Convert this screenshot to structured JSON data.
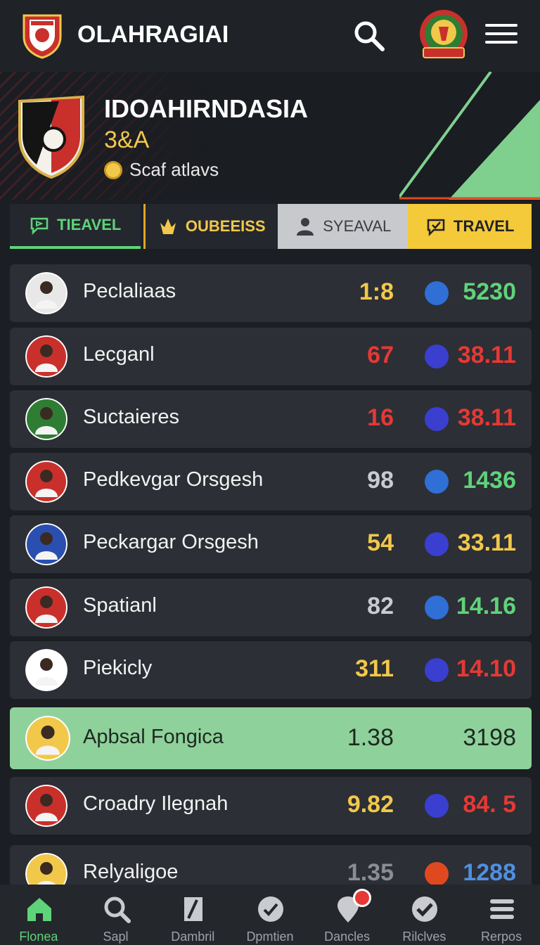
{
  "header": {
    "title": "OLAHRAGIAI",
    "search_icon": "search-icon",
    "menu_icon": "menu-icon"
  },
  "hero": {
    "team_name": "IDOAHIRNDASIA",
    "subtitle": "3&A",
    "meta_text": "Scaf atlavs"
  },
  "tabs": [
    {
      "label": "TIEAVEL",
      "icon": "chat-icon",
      "active": true
    },
    {
      "label": "OUBEEISS",
      "icon": "crown-icon"
    },
    {
      "label": "SYEAVAL",
      "icon": "user-icon"
    },
    {
      "label": "TRAVEL",
      "icon": "chat-check-icon"
    }
  ],
  "rows": [
    {
      "name": "Peclaliaas",
      "score": "1:8",
      "score_color": "#f2c84b",
      "dot_color": "#2f6fd6",
      "value": "5230",
      "value_color": "#5fd37a"
    },
    {
      "name": "Lecganl",
      "score": "67",
      "score_color": "#e53935",
      "dot_color": "#3a3fd0",
      "value": "38.11",
      "value_color": "#e53935"
    },
    {
      "name": "Suctaieres",
      "score": "16",
      "score_color": "#e53935",
      "dot_color": "#3a3fd0",
      "value": "38.11",
      "value_color": "#e53935"
    },
    {
      "name": "Pedkevgar Orsgesh",
      "score": "98",
      "score_color": "#c9cbd0",
      "dot_color": "#2f6fd6",
      "value": "1436",
      "value_color": "#5fd37a"
    },
    {
      "name": "Peckargar Orsgesh",
      "score": "54",
      "score_color": "#f2c84b",
      "dot_color": "#3a3fd0",
      "value": "33.11",
      "value_color": "#f2c84b"
    },
    {
      "name": "Spatianl",
      "score": "82",
      "score_color": "#c9cbd0",
      "dot_color": "#2f6fd6",
      "value": "14.16",
      "value_color": "#5fd37a"
    },
    {
      "name": "Piekicly",
      "score": "311",
      "score_color": "#f2c84b",
      "dot_color": "#3a3fd0",
      "value": "14.10",
      "value_color": "#e53935"
    },
    {
      "name": "Apbsal Fongica",
      "score": "1.38",
      "score_color": "#1c2a1f",
      "dot_color": "",
      "value": "3198",
      "value_color": "#1c2a1f",
      "highlight": true
    },
    {
      "name": "Croadry Ilegnah",
      "score": "9.82",
      "score_color": "#f2c84b",
      "dot_color": "#3a3fd0",
      "value": "84. 5",
      "value_color": "#e53935"
    },
    {
      "name": "Relyaligoe",
      "score": "1.35",
      "score_color": "#8a8d92",
      "dot_color": "#e0491f",
      "value": "1288",
      "value_color": "#4f8fe0"
    }
  ],
  "nav": [
    {
      "label": "Flonea",
      "icon": "home-icon",
      "active": true
    },
    {
      "label": "Sapl",
      "icon": "search-icon"
    },
    {
      "label": "Dambril",
      "icon": "document-icon"
    },
    {
      "label": "Dpmtien",
      "icon": "check-circle-icon"
    },
    {
      "label": "Dancles",
      "icon": "location-pin-icon"
    },
    {
      "label": "Rilclves",
      "icon": "check-badge-icon"
    },
    {
      "label": "Rerpos",
      "icon": "list-icon"
    }
  ],
  "colors": {
    "accent_green": "#5fd37a",
    "accent_yellow": "#f4c93a",
    "background": "#1b1e23",
    "row_background": "#2c2f35",
    "highlight_row": "#8fd19b"
  }
}
